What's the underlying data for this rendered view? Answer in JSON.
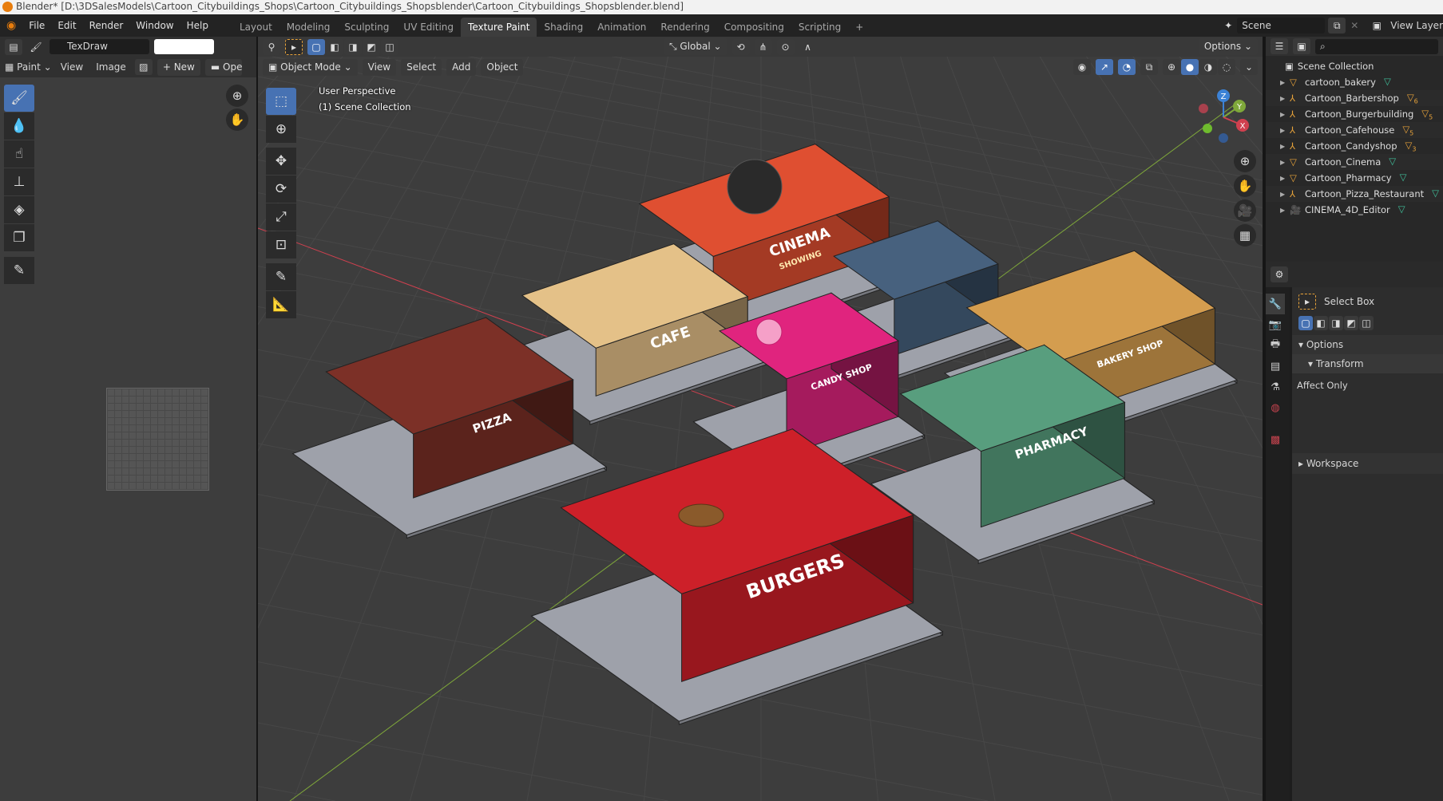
{
  "window_title": "Blender* [D:\\3DSalesModels\\Cartoon_Citybuildings_Shops\\Cartoon_Citybuildings_Shopsblender\\Cartoon_Citybuildings_Shopsblender.blend]",
  "menu": [
    "File",
    "Edit",
    "Render",
    "Window",
    "Help"
  ],
  "workspaces": [
    "Layout",
    "Modeling",
    "Sculpting",
    "UV Editing",
    "Texture Paint",
    "Shading",
    "Animation",
    "Rendering",
    "Compositing",
    "Scripting"
  ],
  "active_workspace": "Texture Paint",
  "scene": {
    "name": "Scene",
    "view_layer": "View Layer"
  },
  "image_editor": {
    "brush_name": "TexDraw",
    "mode": "Paint",
    "menus": [
      "View",
      "Image"
    ],
    "new_label": "New",
    "open_label": "Open"
  },
  "viewport": {
    "mode": "Object Mode",
    "menus": [
      "View",
      "Select",
      "Add",
      "Object"
    ],
    "transform_orientation": "Global",
    "options_label": "Options",
    "overlay_line1": "User Perspective",
    "overlay_line2": "(1) Scene Collection",
    "gizmo_axes": {
      "x": "X",
      "y": "Y",
      "z": "Z"
    },
    "axis_colors": {
      "x": "#d0404f",
      "y": "#7fa83a",
      "z": "#3c82d6"
    },
    "signs": {
      "cinema": "CINEMA",
      "showing": "SHOWING",
      "cafe": "CAFE",
      "candy": "CANDY SHOP",
      "bakery": "BAKERY SHOP",
      "pharmacy": "PHARMACY",
      "burgers": "BURGERS",
      "pizza": "PIZZA"
    }
  },
  "outliner": {
    "root": "Scene Collection",
    "items": [
      {
        "name": "cartoon_bakery",
        "type": "mesh",
        "badge": ""
      },
      {
        "name": "Cartoon_Barbershop",
        "type": "empty",
        "badge": "6"
      },
      {
        "name": "Cartoon_Burgerbuilding",
        "type": "empty",
        "badge": "5"
      },
      {
        "name": "Cartoon_Cafehouse",
        "type": "empty",
        "badge": "5"
      },
      {
        "name": "Cartoon_Candyshop",
        "type": "empty",
        "badge": "3"
      },
      {
        "name": "Cartoon_Cinema",
        "type": "mesh",
        "badge": ""
      },
      {
        "name": "Cartoon_Pharmacy",
        "type": "mesh",
        "badge": ""
      },
      {
        "name": "Cartoon_Pizza_Restaurant",
        "type": "empty",
        "badge": ""
      },
      {
        "name": "CINEMA_4D_Editor",
        "type": "camera",
        "badge": ""
      }
    ]
  },
  "properties": {
    "tool_name": "Select Box",
    "options_label": "Options",
    "transform_label": "Transform",
    "affect_only_label": "Affect Only",
    "workspace_label": "Workspace"
  },
  "colors": {
    "accent": "#4772b3",
    "viewport_bg": "#3d3d3d",
    "panel_bg": "#303030"
  }
}
